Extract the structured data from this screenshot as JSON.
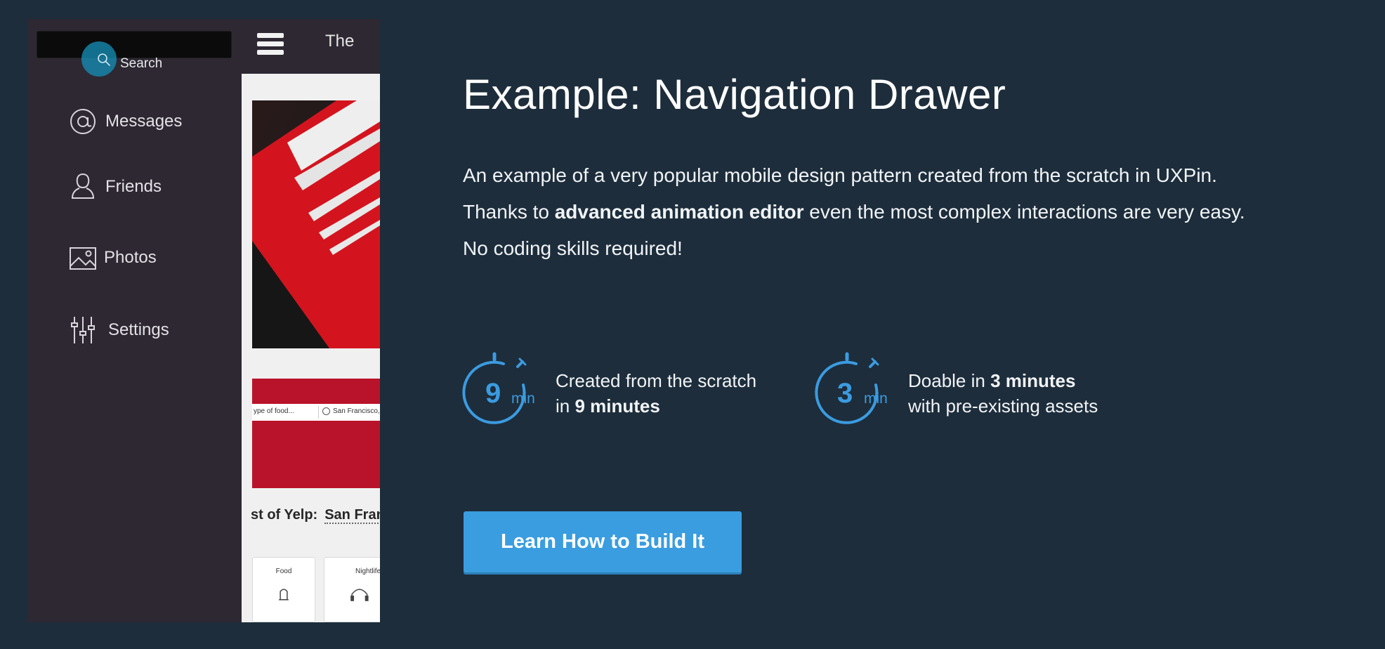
{
  "phone": {
    "search_label": "Search",
    "topbar_title": "The",
    "drawer_items": [
      {
        "label": "Messages",
        "icon": "at-icon"
      },
      {
        "label": "Friends",
        "icon": "person-icon"
      },
      {
        "label": "Photos",
        "icon": "photo-icon"
      },
      {
        "label": "Settings",
        "icon": "sliders-icon"
      }
    ],
    "yelp": {
      "search_placeholder": "ype of food...",
      "location_value": "San Francisco, C",
      "best_of_label": "st of Yelp:",
      "best_of_city": "San Franc",
      "categories": [
        "Food",
        "Nightlife"
      ]
    }
  },
  "hero": {
    "headline": "Example: Navigation Drawer",
    "desc_line1": "An example of a very popular mobile design pattern created from the scratch in UXPin.",
    "desc_line2_prefix": "Thanks to ",
    "desc_line2_bold": "advanced animation editor",
    "desc_line2_suffix": " even the most complex interactions are very easy.",
    "desc_line3": "No coding skills required!"
  },
  "stats": [
    {
      "number": "9",
      "unit": "min",
      "line1_prefix": "Created from the scratch",
      "line1_bold": "",
      "line2_prefix": "in ",
      "line2_bold": "9 minutes",
      "line2_suffix": ""
    },
    {
      "number": "3",
      "unit": "min",
      "line1_prefix": "Doable in ",
      "line1_bold": "3 minutes",
      "line2_prefix": "with pre-existing assets",
      "line2_bold": "",
      "line2_suffix": ""
    }
  ],
  "cta": {
    "label": "Learn How to Build It"
  },
  "colors": {
    "page_bg": "#1d2d3b",
    "accent": "#3a9ddf",
    "drawer_bg": "#2e2832",
    "yelp_red": "#b8132a"
  }
}
